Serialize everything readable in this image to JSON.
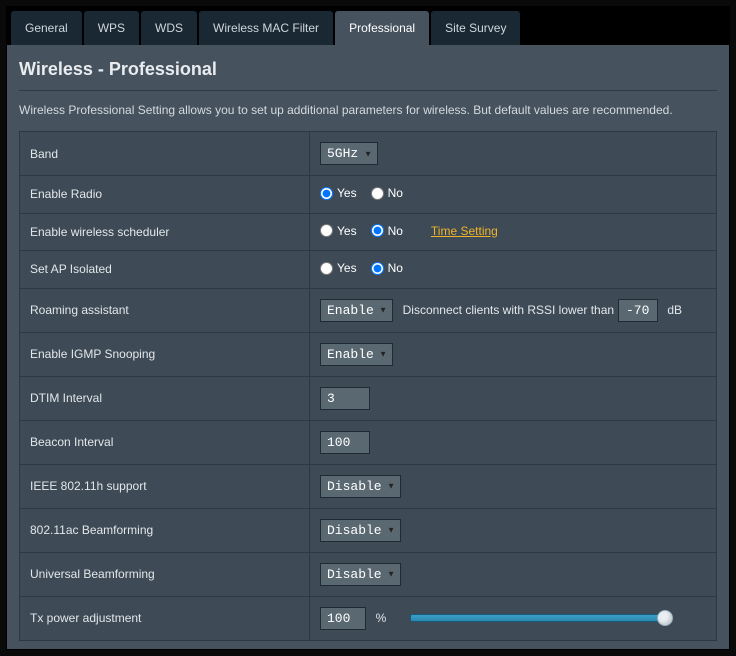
{
  "tabs": {
    "general": "General",
    "wps": "WPS",
    "wds": "WDS",
    "mac": "Wireless MAC Filter",
    "professional": "Professional",
    "survey": "Site Survey"
  },
  "page": {
    "title": "Wireless - Professional",
    "description": "Wireless Professional Setting allows you to set up additional parameters for wireless. But default values are recommended."
  },
  "labels": {
    "band": "Band",
    "enable_radio": "Enable Radio",
    "enable_scheduler": "Enable wireless scheduler",
    "set_ap_isolated": "Set AP Isolated",
    "roaming": "Roaming assistant",
    "igmp": "Enable IGMP Snooping",
    "dtim": "DTIM Interval",
    "beacon": "Beacon Interval",
    "ieee80211h": "IEEE 802.11h support",
    "beamforming_ac": "802.11ac Beamforming",
    "beamforming_uni": "Universal Beamforming",
    "txpower": "Tx power adjustment"
  },
  "options": {
    "yes": "Yes",
    "no": "No",
    "enable": "Enable",
    "disable": "Disable",
    "time_setting": "Time Setting",
    "rssi_prefix": "Disconnect clients with RSSI lower than",
    "rssi_suffix": "dB",
    "percent": "%"
  },
  "values": {
    "band": "5GHz",
    "enable_radio": "Yes",
    "enable_scheduler": "No",
    "set_ap_isolated": "No",
    "roaming": "Enable",
    "rssi": "-70",
    "igmp": "Enable",
    "dtim": "3",
    "beacon": "100",
    "ieee80211h": "Disable",
    "beamforming_ac": "Disable",
    "beamforming_uni": "Disable",
    "txpower": "100"
  }
}
